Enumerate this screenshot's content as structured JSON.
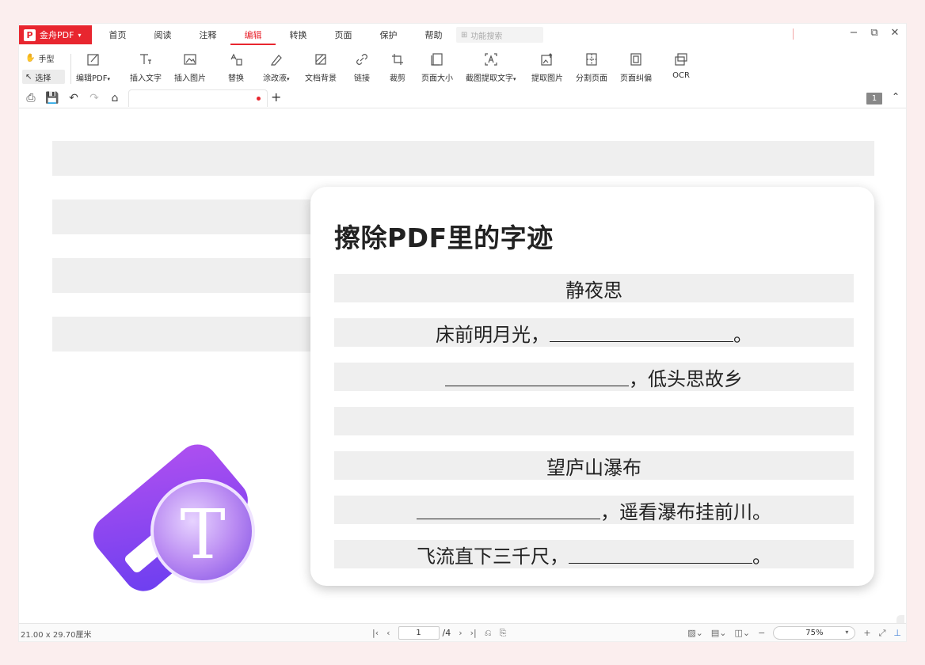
{
  "app": {
    "brand": "金舟PDF",
    "brand_caret": "▾",
    "logo_glyph": "P"
  },
  "menus": [
    "首页",
    "阅读",
    "注释",
    "编辑",
    "转换",
    "页面",
    "保护",
    "帮助"
  ],
  "active_menu": "编辑",
  "search": {
    "placeholder": "功能搜索"
  },
  "modes": {
    "hand": "手型",
    "select": "选择"
  },
  "tools": [
    {
      "label": "编辑PDF",
      "caret": "▾",
      "icon": "edit-pdf-icon"
    },
    {
      "label": "插入文字",
      "icon": "insert-text-icon"
    },
    {
      "label": "插入图片",
      "icon": "insert-image-icon"
    },
    {
      "label": "替换",
      "icon": "replace-icon"
    },
    {
      "label": "涂改液",
      "caret": "▾",
      "icon": "correction-fluid-icon"
    },
    {
      "label": "文档背景",
      "icon": "document-background-icon"
    },
    {
      "label": "链接",
      "icon": "link-icon"
    },
    {
      "label": "裁剪",
      "icon": "crop-icon"
    },
    {
      "label": "页面大小",
      "icon": "page-size-icon"
    },
    {
      "label": "截图提取文字",
      "caret": "▾",
      "icon": "screenshot-ocr-icon"
    },
    {
      "label": "提取图片",
      "icon": "extract-image-icon"
    },
    {
      "label": "分割页面",
      "icon": "split-page-icon"
    },
    {
      "label": "页面纠偏",
      "icon": "page-deskew-icon"
    },
    {
      "label": "OCR",
      "icon": "ocr-icon"
    }
  ],
  "tabbar": {
    "doc_tab_title": "",
    "add_tab": "+",
    "page_badge": "1",
    "collapse": "⌃"
  },
  "card": {
    "title": "擦除PDF里的字迹",
    "lines": [
      {
        "type": "text",
        "text": "静夜思"
      },
      {
        "type": "blank_after",
        "text": "床前明月光，",
        "tail": "。"
      },
      {
        "type": "blank_before",
        "text": "，低头思故乡"
      },
      {
        "type": "empty"
      },
      {
        "type": "text",
        "text": "望庐山瀑布"
      },
      {
        "type": "blank_before",
        "text": "，遥看瀑布挂前川。"
      },
      {
        "type": "blank_after",
        "text": "飞流直下三千尺，",
        "tail": "。"
      }
    ]
  },
  "illustration": {
    "glyph": "T",
    "gradient_from": "#6b3ef0",
    "gradient_to": "#c05cf0"
  },
  "statusbar": {
    "page_size": "21.00 x 29.70厘米",
    "current_page": "1",
    "total_pages": "/4",
    "zoom": "75%"
  },
  "colors": {
    "accent": "#e8262f",
    "bar_gray": "#efefef"
  }
}
